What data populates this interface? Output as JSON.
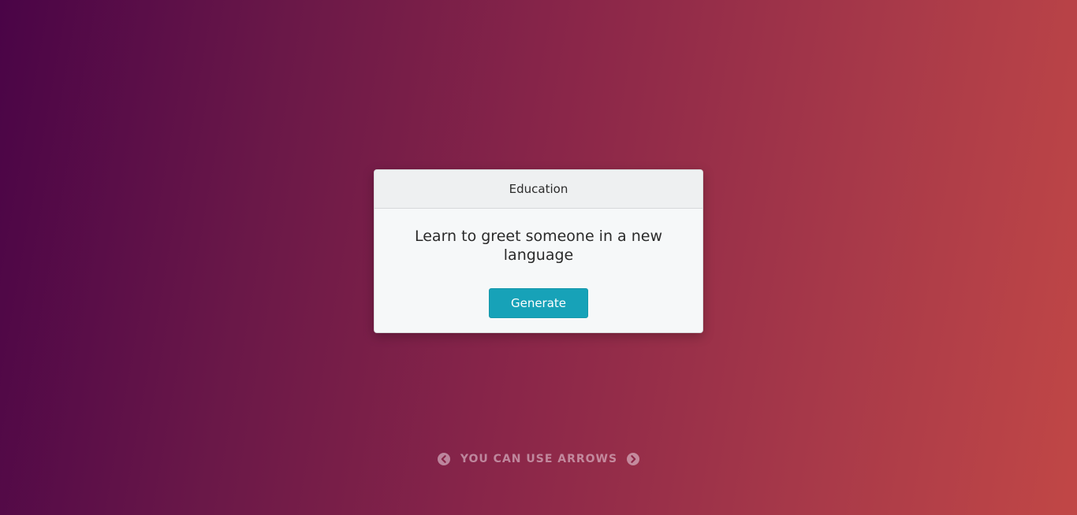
{
  "card": {
    "category": "Education",
    "idea": "Learn to greet someone in a new language",
    "generate_label": "Generate"
  },
  "hint": {
    "text": "YOU CAN USE ARROWS",
    "left_icon": "chevron-left-circle-icon",
    "right_icon": "chevron-right-circle-icon"
  },
  "colors": {
    "button": "#17a2b8",
    "gradient_start": "#4a0447",
    "gradient_end": "#c14746"
  }
}
